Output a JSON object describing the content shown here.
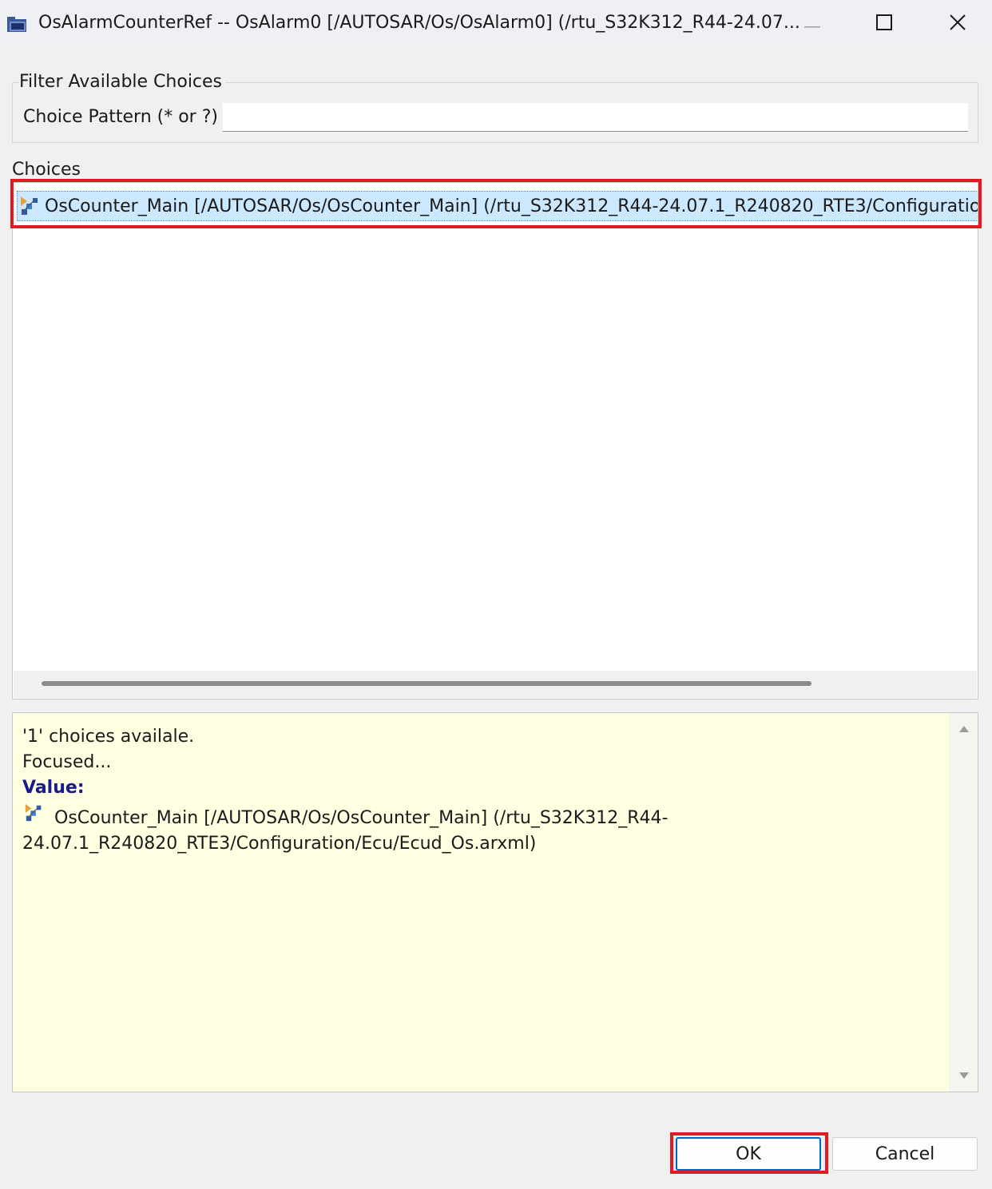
{
  "window": {
    "title": "OsAlarmCounterRef -- OsAlarm0 [/AUTOSAR/Os/OsAlarm0] (/rtu_S32K312_R44-24.07...",
    "icon": "folder-window-icon",
    "controls": [
      "minimize-icon",
      "maximize-icon",
      "close-icon"
    ]
  },
  "filter": {
    "group_title": "Filter Available Choices",
    "pattern_label": "Choice Pattern (* or ?)",
    "pattern_value": ""
  },
  "choices": {
    "label": "Choices",
    "items": [
      {
        "icon": "counter-element-icon",
        "text": "OsCounter_Main [/AUTOSAR/Os/OsCounter_Main] (/rtu_S32K312_R44-24.07.1_R240820_RTE3/Configuration/Ecu/Ecud_Os.arxml)",
        "selected": true
      }
    ]
  },
  "info": {
    "line1": "'1' choices availale.",
    "line2": "Focused...",
    "value_label": "Value:",
    "value_line1": "OsCounter_Main [/AUTOSAR/Os/OsCounter_Main] (/rtu_S32K312_R44-",
    "value_line2": "24.07.1_R240820_RTE3/Configuration/Ecu/Ecud_Os.arxml)"
  },
  "buttons": {
    "ok": "OK",
    "cancel": "Cancel"
  },
  "colors": {
    "selection": "#cce8ff",
    "info_background": "#ffffe1",
    "annotation_highlight": "#e01b24",
    "value_label": "#1a1a8c"
  }
}
